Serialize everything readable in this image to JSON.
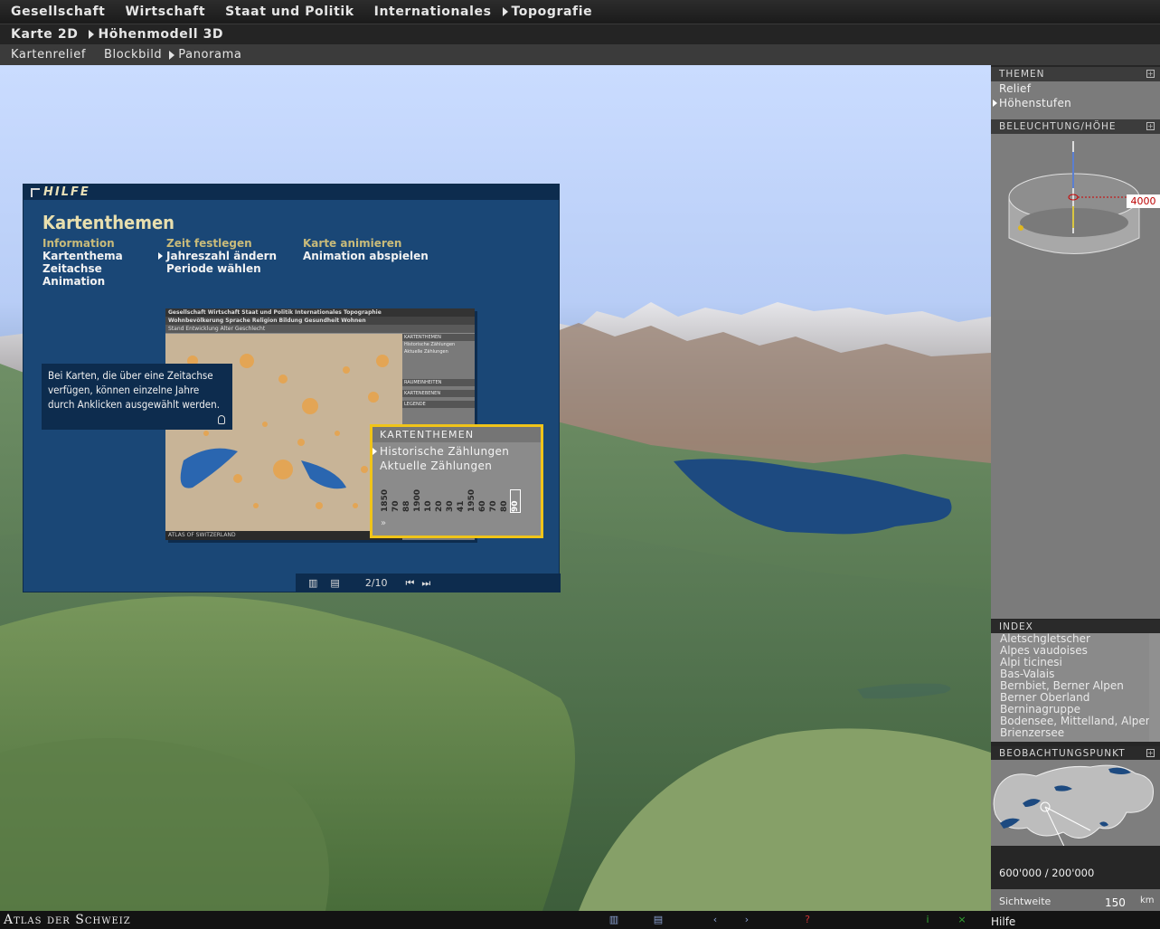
{
  "nav": {
    "row1": [
      "Gesellschaft",
      "Wirtschaft",
      "Staat und Politik",
      "Internationales",
      "Topografie"
    ],
    "row2": [
      "Karte 2D",
      "Höhenmodell 3D"
    ],
    "row3": [
      "Kartenrelief",
      "Blockbild",
      "Panorama"
    ]
  },
  "help": {
    "header": "HILFE",
    "title": "Kartenthemen",
    "columns": [
      {
        "heading": "Information",
        "items": [
          "Kartenthema",
          "Zeitachse",
          "Animation"
        ]
      },
      {
        "heading": "Zeit festlegen",
        "items": [
          "Jahreszahl ändern",
          "Periode wählen"
        ]
      },
      {
        "heading": "Karte animieren",
        "items": [
          "Animation abspielen"
        ]
      }
    ],
    "tooltip": "Bei Karten, die über eine Zeitachse verfügen, können einzelne Jahre durch Anklicken ausgewählt werden.",
    "mini_nav1": "Gesellschaft   Wirtschaft   Staat und Politik   Internationales   Topographie",
    "mini_nav2": "Wohnbevölkerung   Sprache   Religion   Bildung   Gesundheit   Wohnen",
    "mini_nav3": "Stand   Entwicklung   Alter   Geschlecht",
    "mini_side": [
      "KARTENTHEMEN",
      "Historische Zählungen",
      "Aktuelle Zählungen",
      "RAUMEINHEITEN",
      "KARTENEBENEN",
      "LEGENDE"
    ],
    "mini_foot": "ATLAS OF SWITZERLAND",
    "callout_title": "KARTENTHEMEN",
    "callout_items": [
      "Historische Zählungen",
      "Aktuelle Zählungen"
    ],
    "years": [
      "1850",
      "70",
      "88",
      "1900",
      "10",
      "20",
      "30",
      "41",
      "1950",
      "60",
      "70",
      "80",
      "90"
    ],
    "page": "2/10"
  },
  "sidebar": {
    "themen_title": "THEMEN",
    "themen": [
      "Relief",
      "Höhenstufen"
    ],
    "light_title": "BELEUCHTUNG/HÖHE",
    "height_value": "4000",
    "index_title": "INDEX",
    "index_items": [
      "Aletschgletscher",
      "Alpes vaudoises",
      "Alpi ticinesi",
      "Bas-Valais",
      "Bernbiet, Berner Alpen",
      "Berner Oberland",
      "Berninagruppe",
      "Bodensee, Mittelland, Alpen",
      "Brienzersee"
    ],
    "observe_title": "BEOBACHTUNGSPUNKT",
    "coordinates": "600'000 / 200'000",
    "sight_label": "Sichtweite",
    "sight_value": "150",
    "sight_unit": "km"
  },
  "footer": {
    "brand": "Atlas der Schweiz",
    "help": "Hilfe"
  },
  "colors": {
    "accent_yellow": "#f0c419",
    "help_blue": "#1a4776",
    "sky": "#b8cdf6",
    "water": "#1d4a80"
  }
}
